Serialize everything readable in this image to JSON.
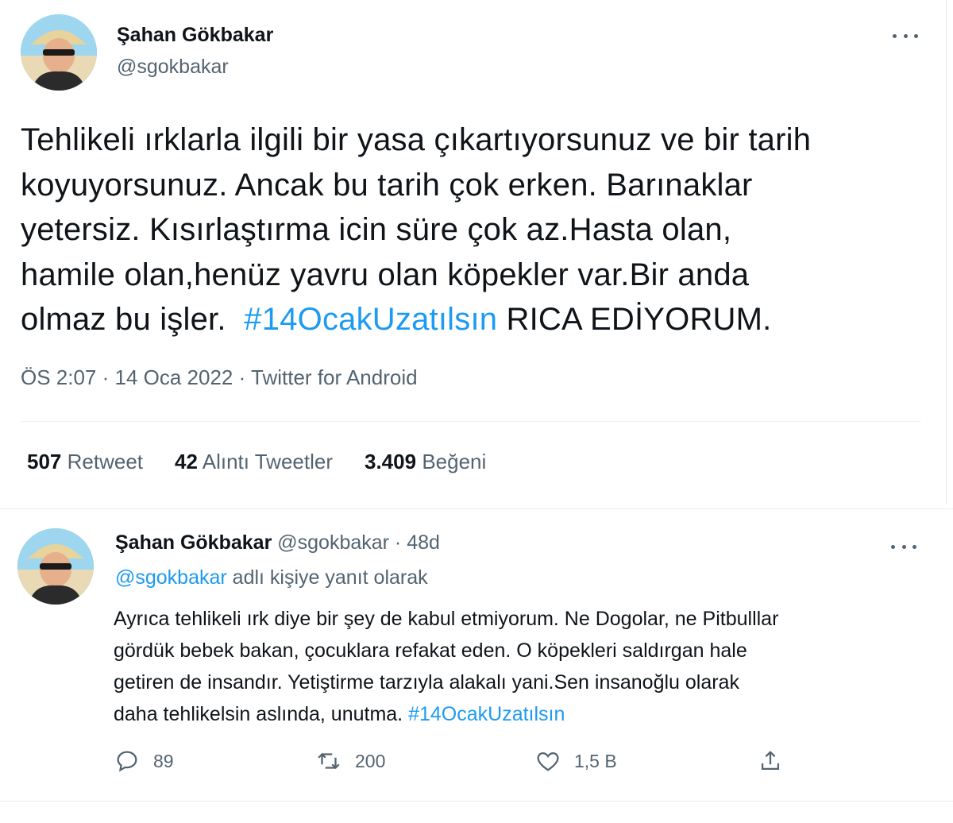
{
  "main_tweet": {
    "author_name": "Şahan Gökbakar",
    "author_handle": "@sgokbakar",
    "text_lines": [
      "Tehlikeli ırklarla ilgili bir yasa çıkartıyorsunuz ve bir tarih",
      "koyuyorsunuz. Ancak bu tarih çok erken. Barınaklar",
      "yetersiz. Kısırlaştırma icin süre çok az.Hasta olan,",
      "hamile olan,henüz yavru olan köpekler var.Bir anda",
      "olmaz bu işler.  "
    ],
    "hashtag": "#14OcakUzatılsın",
    "text_tail": " RICA EDİYORUM.",
    "meta": "ÖS 2:07 · 14 Oca 2022 · Twitter for Android",
    "stats": {
      "retweet_count": "507",
      "retweet_label": "Retweet",
      "quote_count": "42",
      "quote_label": "Alıntı Tweetler",
      "like_count": "3.409",
      "like_label": "Beğeni"
    }
  },
  "reply_tweet": {
    "author_name": "Şahan Gökbakar",
    "author_handle_time": " @sgokbakar · 48d",
    "reply_to_mention": "@sgokbakar",
    "reply_to_suffix": " adlı kişiye yanıt olarak",
    "text_lines": [
      "Ayrıca tehlikeli ırk diye bir şey de kabul etmiyorum. Ne Dogolar, ne Pitbulllar",
      "gördük bebek bakan, çocuklara refakat eden. O köpekleri saldırgan hale",
      "getiren de insandır. Yetiştirme tarzıyla alakalı yani.Sen insanoğlu olarak",
      "daha tehlikelsin aslında, unutma. "
    ],
    "hashtag": "#14OcakUzatılsın",
    "actions": {
      "reply_count": "89",
      "retweet_count": "200",
      "like_count": "1,5 B"
    }
  },
  "icons": [
    "avatar",
    "more-icon",
    "reply-icon",
    "retweet-icon",
    "like-icon",
    "share-icon"
  ],
  "colors": {
    "accent": "#1d9bf0",
    "secondary_text": "#536471",
    "primary_text": "#0f1419"
  }
}
